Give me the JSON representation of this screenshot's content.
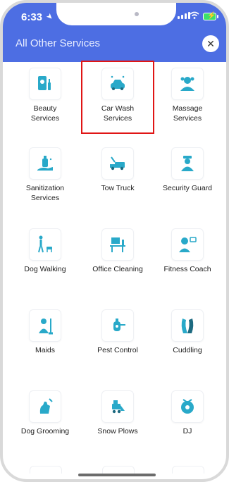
{
  "status": {
    "time": "6:33"
  },
  "header": {
    "title": "All Other Services",
    "close_icon": "close-icon"
  },
  "services": [
    {
      "label": "Beauty\nServices",
      "icon": "beauty-icon"
    },
    {
      "label": "Car Wash\nServices",
      "icon": "car-wash-icon",
      "selected": true
    },
    {
      "label": "Massage\nServices",
      "icon": "massage-icon"
    },
    {
      "label": "Sanitization\nServices",
      "icon": "sanitization-icon"
    },
    {
      "label": "Tow Truck",
      "icon": "tow-truck-icon"
    },
    {
      "label": "Security Guard",
      "icon": "security-guard-icon"
    },
    {
      "label": "Dog Walking",
      "icon": "dog-walking-icon"
    },
    {
      "label": "Office Cleaning",
      "icon": "office-cleaning-icon"
    },
    {
      "label": "Fitness Coach",
      "icon": "fitness-coach-icon"
    },
    {
      "label": "Maids",
      "icon": "maid-icon"
    },
    {
      "label": "Pest Control",
      "icon": "pest-control-icon"
    },
    {
      "label": "Cuddling",
      "icon": "cuddling-icon"
    },
    {
      "label": "Dog Grooming",
      "icon": "dog-grooming-icon"
    },
    {
      "label": "Snow Plows",
      "icon": "snow-plow-icon"
    },
    {
      "label": "DJ",
      "icon": "dj-icon"
    }
  ],
  "colors": {
    "accent": "#4d6ee3",
    "icon": "#29a9c9",
    "selection": "#e01515"
  }
}
